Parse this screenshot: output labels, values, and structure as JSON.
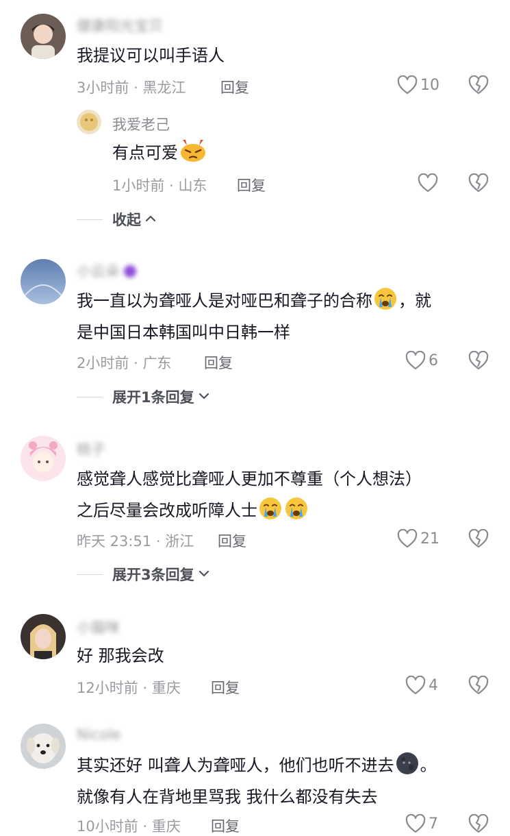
{
  "comments": [
    {
      "username": "健康阳光宝贝",
      "text": "我提议可以叫手语人",
      "time": "3小时前",
      "location": "黑龙江",
      "reply_label": "回复",
      "likes": "10",
      "replies": [
        {
          "username": "我爱老己",
          "text": "有点可爱",
          "time": "1小时前",
          "location": "山东",
          "reply_label": "回复",
          "likes": ""
        }
      ],
      "collapse_label": "收起"
    },
    {
      "username": "小云朵",
      "text_line1": "我一直以为聋哑人是对哑巴和聋子的合称",
      "text_line1_tail": "，就",
      "text_line2": "是中国日本韩国叫中日韩一样",
      "time": "2小时前",
      "location": "广东",
      "reply_label": "回复",
      "likes": "6",
      "expand_label": "展开1条回复"
    },
    {
      "username": "桃子",
      "text_line1": "感觉聋人感觉比聋哑人更加不尊重（个人想法）",
      "text_line2": "之后尽量会改成听障人士",
      "time": "昨天 23:51",
      "location": "浙江",
      "reply_label": "回复",
      "likes": "21",
      "expand_label": "展开3条回复"
    },
    {
      "username": "小猫咪",
      "text": "好 那我会改",
      "time": "12小时前",
      "location": "重庆",
      "reply_label": "回复",
      "likes": "4"
    },
    {
      "username": "Nicole",
      "text_line1": "其实还好 叫聋人为聋哑人，他们也听不进去",
      "text_line1_tail": "。",
      "text_line2": "就像有人在背地里骂我 我什么都没有失去",
      "time": "10小时前",
      "location": "重庆",
      "reply_label": "回复",
      "likes": "7"
    }
  ],
  "separator": "·",
  "icons": [
    "heart-icon",
    "dislike-icon",
    "chevron-up-icon",
    "chevron-down-icon"
  ],
  "colors": {
    "text": "#161823",
    "meta": "#9a9ba0",
    "icon": "#8a8b91",
    "background": "#ffffff"
  }
}
